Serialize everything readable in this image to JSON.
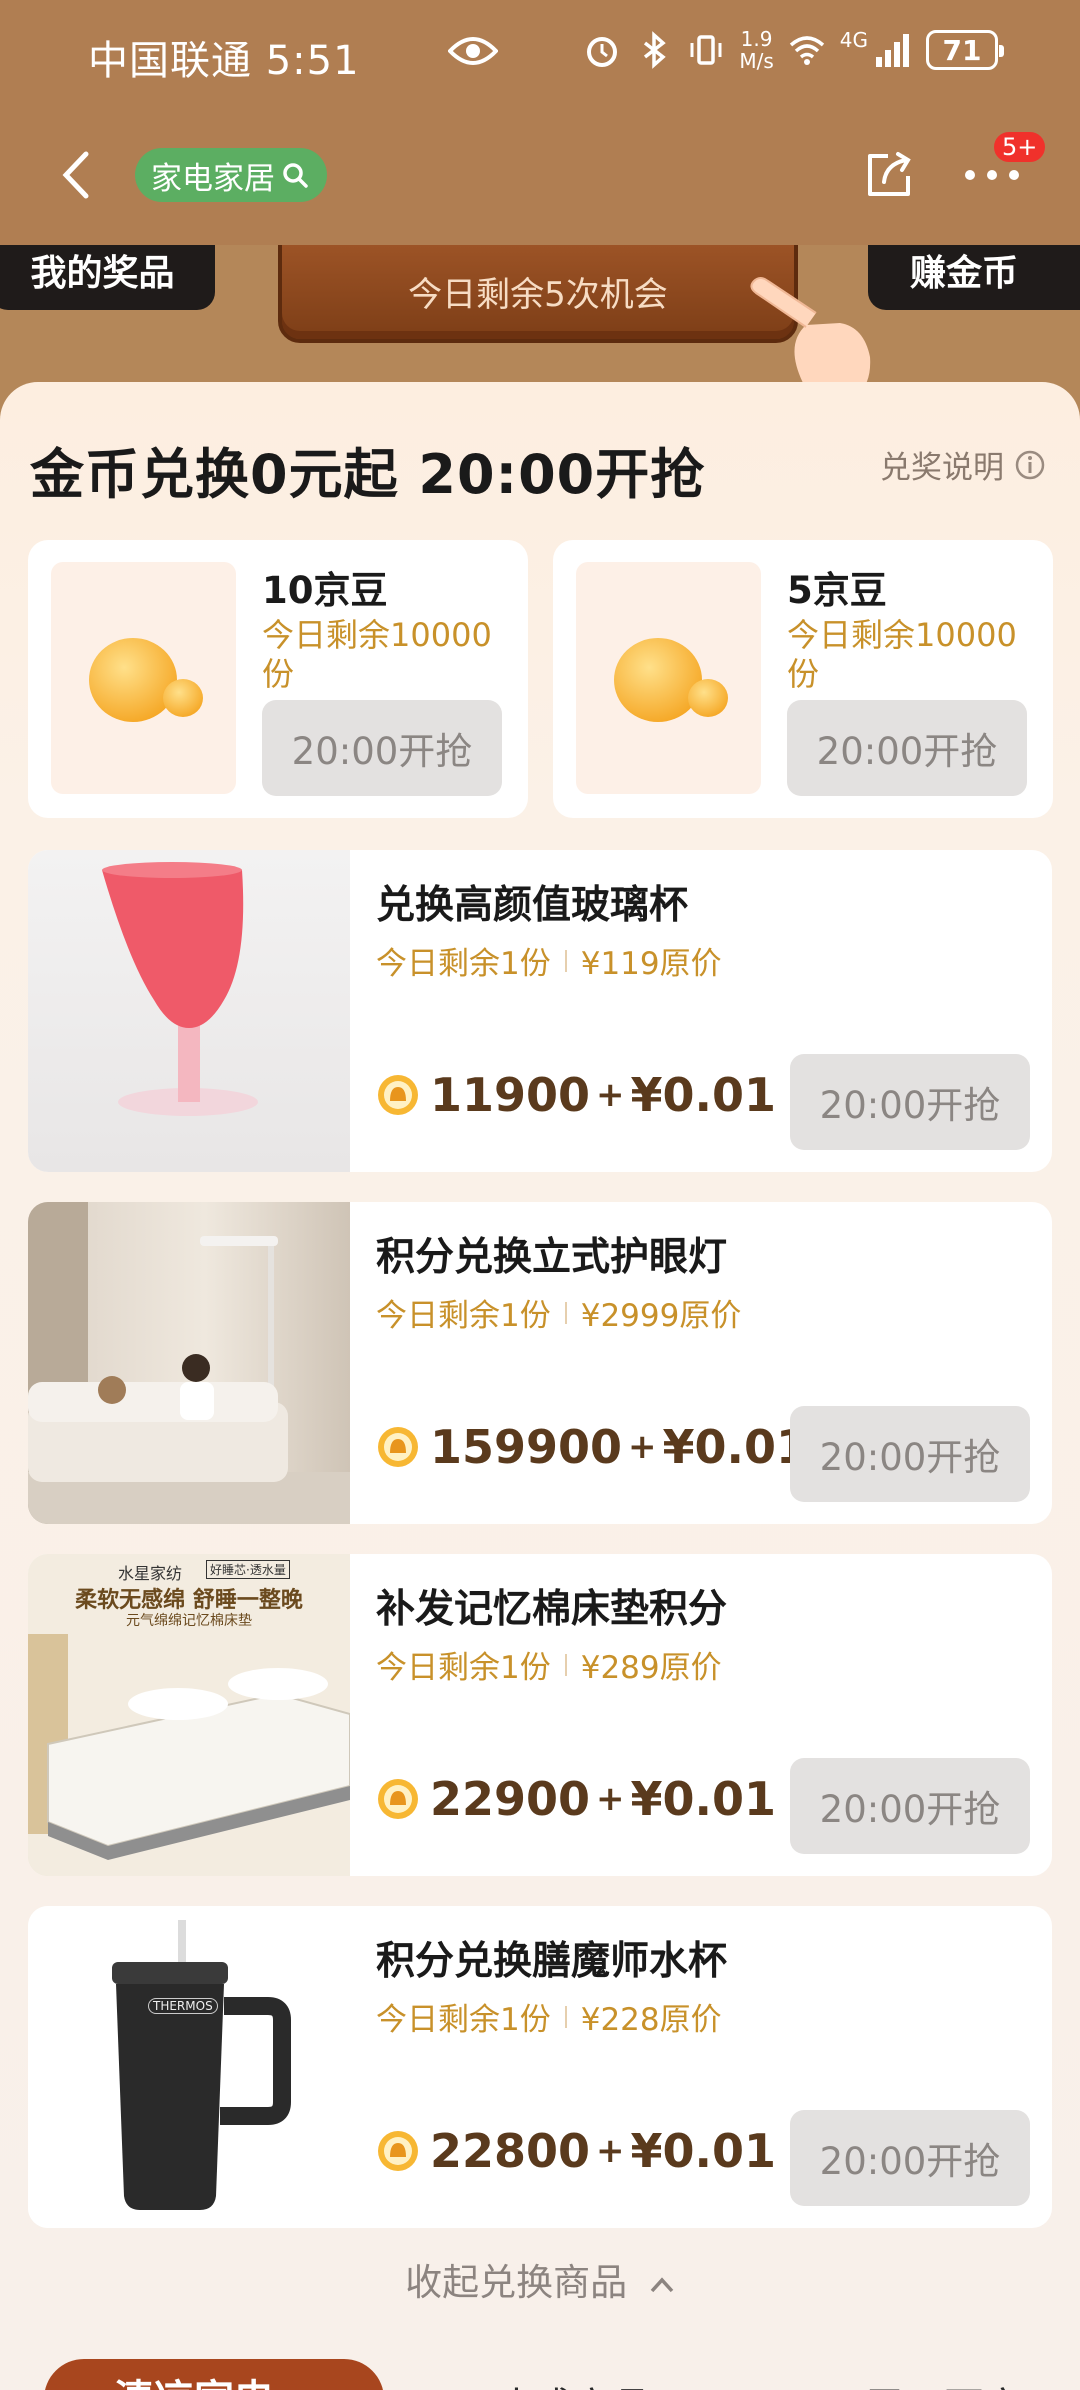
{
  "status_bar": {
    "carrier_time": "中国联通 5:51",
    "net_speed_top": "1.9",
    "net_speed_unit": "M/s",
    "network": "4G",
    "battery": "71"
  },
  "nav": {
    "search_label": "家电家居",
    "badge": "5+"
  },
  "strip": {
    "left_label": "我的奖品",
    "chance_label": "今日剩余5次机会",
    "right_label": "赚金币"
  },
  "panel": {
    "title": "金币兑换0元起  20:00开抢",
    "rules_label": "兑奖说明"
  },
  "beans": [
    {
      "name": "10京豆",
      "remain": "今日剩余10000份",
      "button": "20:00开抢"
    },
    {
      "name": "5京豆",
      "remain": "今日剩余10000份",
      "button": "20:00开抢"
    }
  ],
  "products": [
    {
      "name": "兑换高颜值玻璃杯",
      "remain": "今日剩余1份",
      "original_price": "¥119原价",
      "coins": "11900",
      "plus": "+",
      "cash": "¥0.01",
      "button": "20:00开抢"
    },
    {
      "name": "积分兑换立式护眼灯",
      "remain": "今日剩余1份",
      "original_price": "¥2999原价",
      "coins": "159900",
      "plus": "+",
      "cash": "¥0.01",
      "button": "20:00开抢"
    },
    {
      "name": "补发记忆棉床垫积分",
      "remain": "今日剩余1份",
      "original_price": "¥289原价",
      "coins": "22900",
      "plus": "+",
      "cash": "¥0.01",
      "button": "20:00开抢",
      "image_text": {
        "brand": "水星家纺",
        "tag": "好睡芯·透水量",
        "headline": "柔软无感绵 舒睡一整晚",
        "sub": "元气绵绵记忆棉床垫"
      }
    },
    {
      "name": "积分兑换膳魔师水杯",
      "remain": "今日剩余1份",
      "original_price": "¥228原价",
      "coins": "22800",
      "plus": "+",
      "cash": "¥0.01",
      "button": "20:00开抢",
      "image_text": {
        "brand": "THERMOS"
      }
    }
  ],
  "collapse_label": "收起兑换商品",
  "bottom_tabs": [
    {
      "label": "清凉家电"
    },
    {
      "label": "冰感商品"
    },
    {
      "label": "居田百市"
    }
  ],
  "colors": {
    "header_bg": "#b07e52",
    "accent_gold": "#c8912a",
    "search_green": "#5cae62",
    "badge_red": "#f0312b",
    "disabled_button": "#e3e1e0"
  }
}
